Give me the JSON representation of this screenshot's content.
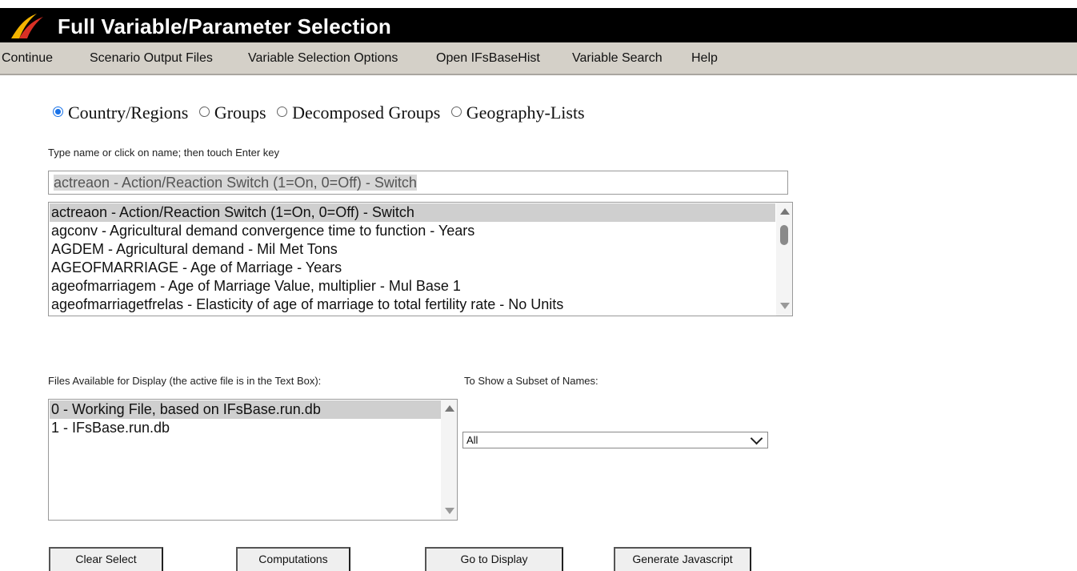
{
  "window": {
    "title": "Full Variable/Parameter Selection"
  },
  "menu": [
    "Continue",
    "Scenario Output Files",
    "Variable Selection Options",
    "Open IFsBaseHist",
    "Variable Search",
    "Help"
  ],
  "radios": [
    {
      "label": "Country/Regions",
      "checked": true
    },
    {
      "label": "Groups",
      "checked": false
    },
    {
      "label": "Decomposed Groups",
      "checked": false
    },
    {
      "label": "Geography-Lists",
      "checked": false
    }
  ],
  "instruction": "Type name or click on name; then touch Enter key",
  "search_value": "actreaon - Action/Reaction Switch (1=On, 0=Off) - Switch",
  "variables": [
    "actreaon - Action/Reaction Switch (1=On, 0=Off) - Switch",
    "agconv - Agricultural demand convergence time to function - Years",
    "AGDEM - Agricultural demand - Mil Met Tons",
    "AGEOFMARRIAGE - Age of Marriage - Years",
    "ageofmarriagem - Age of Marriage Value, multiplier - Mul Base 1",
    "ageofmarriagetfrelas - Elasticity of age of marriage to total fertility rate - No Units"
  ],
  "files_label": "Files Available for Display (the active file is in the Text Box):",
  "files": [
    "0 - Working File, based on IFsBase.run.db",
    "1 - IFsBase.run.db"
  ],
  "subset_label": "To Show a Subset of Names:",
  "subset_selected": "All",
  "buttons": {
    "clear": "Clear Select",
    "computations": "Computations",
    "display": "Go to Display",
    "javascript": "Generate Javascript"
  },
  "colors": {
    "titlebar": "#000000",
    "menubar": "#d4d0c8",
    "radio_accent": "#1a73e8",
    "selected_row": "#cfcfcf"
  }
}
